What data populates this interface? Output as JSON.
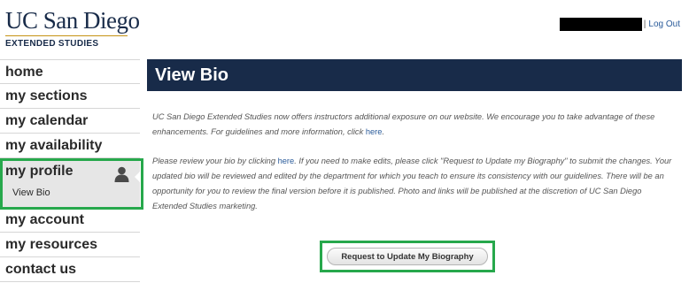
{
  "header": {
    "logo_main": "UC San Diego",
    "logo_sub": "EXTENDED STUDIES",
    "username_redacted": "",
    "separator": "|",
    "logout_label": "Log Out"
  },
  "sidebar": {
    "items": [
      {
        "label": "home"
      },
      {
        "label": "my sections"
      },
      {
        "label": "my calendar"
      },
      {
        "label": "my availability"
      },
      {
        "label": "my profile",
        "sub": "View Bio",
        "icon": "person-icon"
      },
      {
        "label": "my account"
      },
      {
        "label": "my resources"
      },
      {
        "label": "contact us"
      }
    ]
  },
  "main": {
    "title": "View Bio",
    "para1_text": "UC San Diego Extended Studies now offers instructors additional exposure on our website. We encourage you to take advantage of these enhancements. For guidelines and more information, click",
    "para1_link": "here",
    "para2_before": "Please review your bio by clicking",
    "para2_link": "here",
    "para2_after": ". If you need to make edits, please click \"Request to Update my Biography\" to submit the changes. Your updated bio will be reviewed and edited by the department for which you teach to ensure its consistency with our guidelines. There will be an opportunity for you to review the final version before it is published. Photo and links will be published at the discretion of UC San Diego Extended Studies marketing.",
    "button_label": "Request to Update My Biography"
  },
  "colors": {
    "navy": "#182b49",
    "gold": "#c69214",
    "highlight_green": "#27a84c",
    "link_blue": "#2a5b9a"
  }
}
